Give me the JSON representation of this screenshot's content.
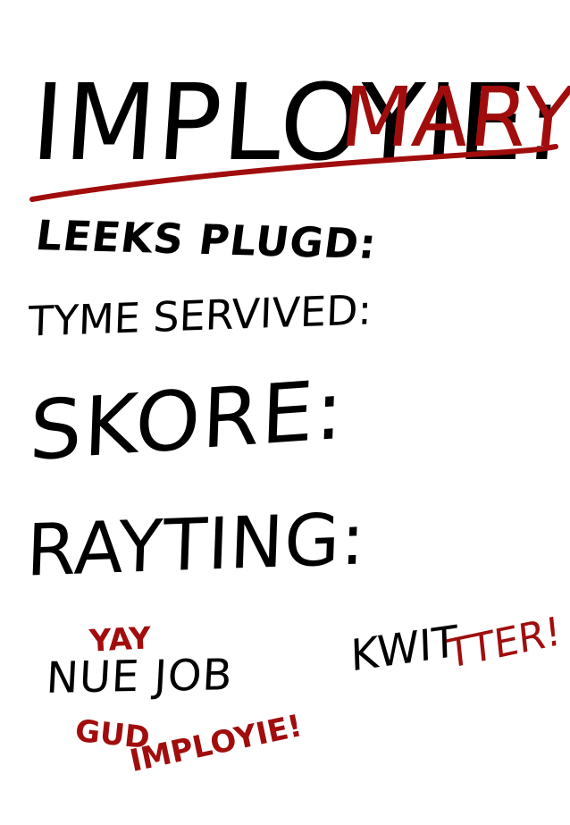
{
  "header": {
    "label": "IMPLOYIE:",
    "name": "MARYO",
    "name_color": "#a10d0d",
    "underline_color": "#a10d0d"
  },
  "stats": {
    "leaks": "LEEKS PLUGD:",
    "time": "TYME SERVIVED:",
    "score": "SKORE:",
    "rating": "RAYTING:"
  },
  "actions": {
    "new_job": {
      "label": "NUE JOB",
      "cheer_top": "YAY",
      "cheer_line_1": "GUD",
      "cheer_line_2": "IMPLOYIE!"
    },
    "quit": {
      "label_black": "KWIT",
      "label_red": "TTER!"
    }
  },
  "colors": {
    "ink": "#000000",
    "accent": "#a10d0d",
    "background": "#ffffff"
  }
}
